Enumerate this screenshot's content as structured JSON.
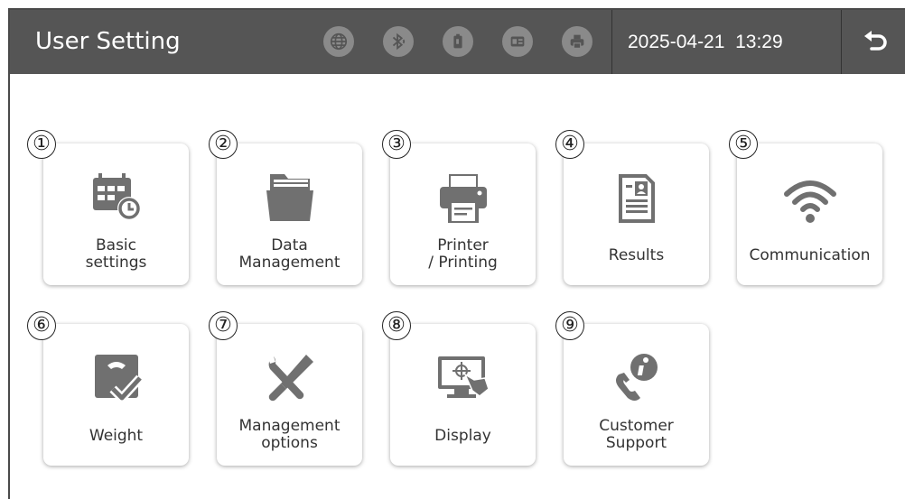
{
  "header": {
    "title": "User Setting",
    "status_icons": [
      "globe-icon",
      "bluetooth-icon",
      "usb-device-icon",
      "card-reader-icon",
      "printer-icon"
    ],
    "date": "2025-04-21",
    "time": "13:29",
    "back_icon": "return-arrow-icon"
  },
  "colors": {
    "header_bg": "#555555",
    "icon_gray": "#707070",
    "status_icon_bg": "#8a8a8a"
  },
  "tiles": [
    {
      "number": "①",
      "label_line1": "Basic",
      "label_line2": "settings",
      "icon": "calendar-clock-icon"
    },
    {
      "number": "②",
      "label_line1": "Data",
      "label_line2": "Management",
      "icon": "folder-icon"
    },
    {
      "number": "③",
      "label_line1": "Printer",
      "label_line2": "/ Printing",
      "icon": "printer-icon"
    },
    {
      "number": "④",
      "label_line1": "Results",
      "label_line2": "",
      "icon": "document-icon"
    },
    {
      "number": "⑤",
      "label_line1": "Communication",
      "label_line2": "",
      "icon": "wifi-icon"
    },
    {
      "number": "⑥",
      "label_line1": "Weight",
      "label_line2": "",
      "icon": "scale-check-icon"
    },
    {
      "number": "⑦",
      "label_line1": "Management",
      "label_line2": "options",
      "icon": "tools-icon"
    },
    {
      "number": "⑧",
      "label_line1": "Display",
      "label_line2": "",
      "icon": "touch-monitor-icon"
    },
    {
      "number": "⑨",
      "label_line1": "Customer",
      "label_line2": "Support",
      "icon": "phone-info-icon"
    }
  ]
}
